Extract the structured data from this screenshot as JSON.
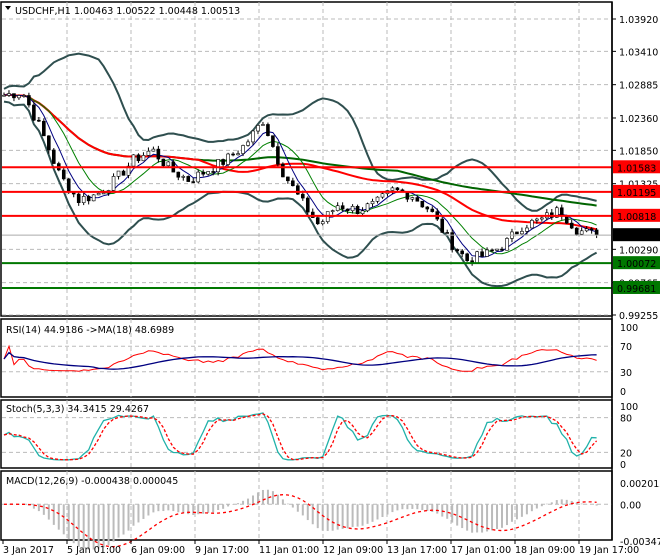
{
  "header": {
    "symbol": "USDCHF,H1",
    "ohlc": "1.00463 1.00522 1.00448 1.00513"
  },
  "chart_data": {
    "type": "candlestick",
    "title": "USDCHF,H1",
    "ylim": [
      0.99255,
      1.0392
    ],
    "price_ticks": [
      "1.03920",
      "1.03410",
      "1.02885",
      "1.02360",
      "1.01850",
      "1.01325",
      "1.00290",
      "0.99765",
      "0.99255"
    ],
    "price_tick_values": [
      1.0392,
      1.0341,
      1.02885,
      1.0236,
      1.0185,
      1.01325,
      1.0029,
      0.99765,
      0.99255
    ],
    "close_path": [
      1.0272,
      1.0277,
      1.0217,
      1.0146,
      1.0107,
      1.0115,
      1.0138,
      1.017,
      1.0186,
      1.0154,
      1.0138,
      1.0154,
      1.017,
      1.0193,
      1.0233,
      1.0154,
      1.0107,
      1.0067,
      1.0099,
      1.0091,
      1.0099,
      1.0122,
      1.0115,
      1.0091,
      1.0044,
      1.0012,
      1.002,
      1.0036,
      1.0067,
      1.0075,
      1.0091,
      1.0059,
      1.00513
    ],
    "levels": [
      {
        "label": "1.01583",
        "value": 1.01583,
        "color": "#ff0000"
      },
      {
        "label": "1.01195",
        "value": 1.01195,
        "color": "#ff0000"
      },
      {
        "label": "1.00818",
        "value": 1.00818,
        "color": "#ff0000"
      },
      {
        "label": "1.00072",
        "value": 1.00072,
        "color": "#007700"
      },
      {
        "label": "0.99681",
        "value": 0.99681,
        "color": "#007700"
      }
    ],
    "current_price": {
      "label": "1.00513",
      "value": 1.00513,
      "color": "#000000"
    },
    "x_ticks": [
      "3 Jan 2017",
      "5 Jan 01:00",
      "6 Jan 09:00",
      "9 Jan 17:00",
      "11 Jan 01:00",
      "12 Jan 09:00",
      "13 Jan 17:00",
      "17 Jan 01:00",
      "18 Jan 09:00",
      "19 Jan 17:00"
    ],
    "indicators": {
      "rsi": {
        "label": "RSI(14) 44.9186  ->MA(18) 48.6989",
        "ticks": [
          "100",
          "70",
          "30",
          "0"
        ],
        "tick_values": [
          100,
          70,
          30,
          0
        ]
      },
      "stoch": {
        "label": "Stoch(5,3,3) 34.3415 29.4267",
        "ticks": [
          "100",
          "80",
          "20",
          "0"
        ],
        "tick_values": [
          100,
          80,
          20,
          0
        ]
      },
      "macd": {
        "label": "MACD(12,26,9) -0.000438 0.000045",
        "ticks": [
          "0.002012",
          "0.00",
          "-0.003476"
        ],
        "tick_values": [
          0.002012,
          0,
          -0.003476
        ]
      }
    }
  }
}
